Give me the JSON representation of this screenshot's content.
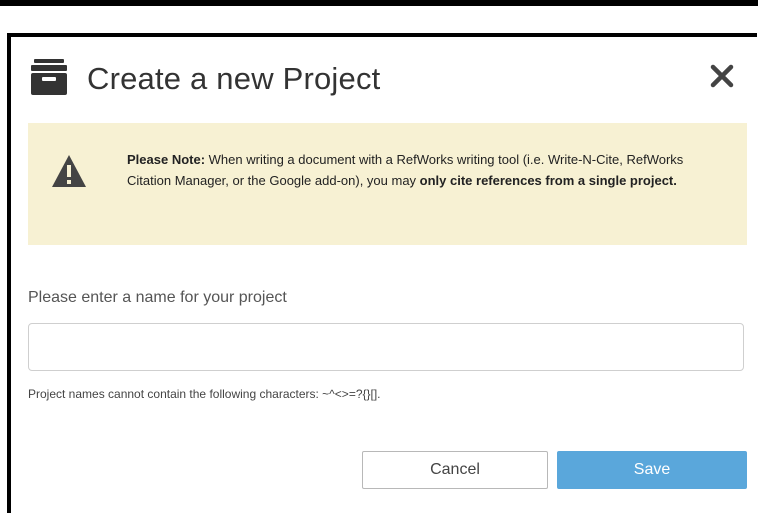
{
  "dialog": {
    "title": "Create a new Project",
    "header_icon": "archive-box-icon",
    "close_icon": "close-icon"
  },
  "note": {
    "icon": "warning-triangle-icon",
    "bold_lead": "Please Note:",
    "text_before": " When writing a document with a RefWorks writing tool (i.e. Write-N-Cite, RefWorks Citation Manager, or the Google add-on), you may ",
    "bold_emphasis": "only cite references from a single project.",
    "background": "#f7f1d3"
  },
  "form": {
    "name_label": "Please enter a name for your project",
    "name_value": "",
    "name_placeholder": "",
    "hint": "Project names cannot contain the following characters: ~^<>=?{}[]."
  },
  "buttons": {
    "cancel_label": "Cancel",
    "save_label": "Save",
    "save_color": "#5aa7db"
  }
}
